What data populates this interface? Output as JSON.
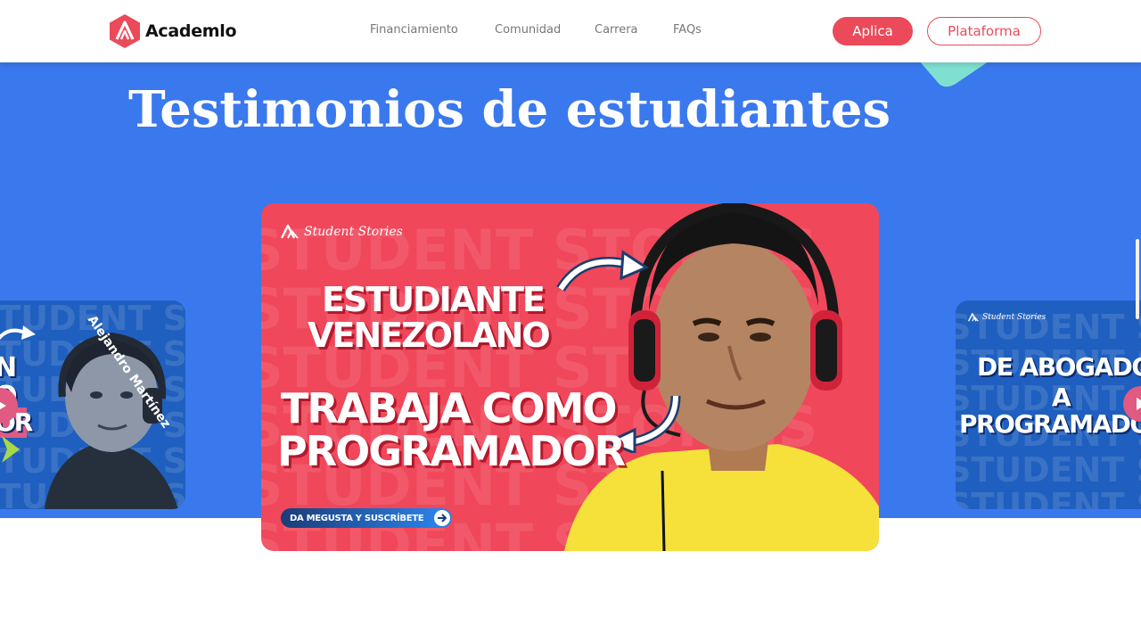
{
  "header": {
    "logo_text": "Academlo",
    "nav": [
      {
        "label": "Financiamiento"
      },
      {
        "label": "Comunidad"
      },
      {
        "label": "Carrera"
      },
      {
        "label": "FAQs"
      }
    ],
    "apply_label": "Aplica",
    "platform_label": "Plataforma"
  },
  "section": {
    "title": "Testimonios de estudiantes"
  },
  "cards": {
    "main": {
      "brand": "Student Stories",
      "line1": "ESTUDIANTE",
      "line2": "VENEZOLANO",
      "line3": "TRABAJA COMO",
      "line4": "PROGRAMADOR",
      "cta": "DA MEGUSTA Y SUSCRÍBETE",
      "bg_text": "STUDENT STORIES"
    },
    "left": {
      "name": "Alejandro Martínez",
      "frag1": "N",
      "frag2": "O",
      "frag3": "OR"
    },
    "right": {
      "brand": "Student Stories",
      "line1": "DE ABOGADO",
      "line2": "A",
      "line3": "PROGRAMADOR"
    }
  },
  "colors": {
    "accent": "#ea4a5a",
    "section_bg": "#3a78ee",
    "card_red": "#f0475a",
    "card_blue": "#1f5fbf",
    "teal_deco": "#7fe0d2"
  },
  "icons": [
    "academlo-logo-icon",
    "play-icon",
    "arrow-right-icon",
    "curved-arrow-icon"
  ]
}
